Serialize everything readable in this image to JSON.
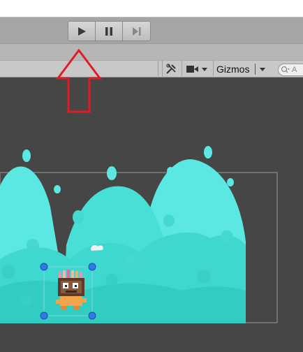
{
  "toolbar": {
    "play_icon": "play-icon",
    "pause_icon": "pause-icon",
    "step_icon": "step-forward-icon"
  },
  "scene_view": {
    "tools_icon": "scene-tools-icon",
    "camera_icon": "camera-icon",
    "gizmos_label": "Gizmos",
    "search_prefix": "A"
  },
  "colors": {
    "annotation_arrow": "#e01b24",
    "hill_light": "#5be8e3",
    "hill_mid": "#46ddd5",
    "hill_dark": "#35cfc6",
    "scene_background": "#464646"
  }
}
